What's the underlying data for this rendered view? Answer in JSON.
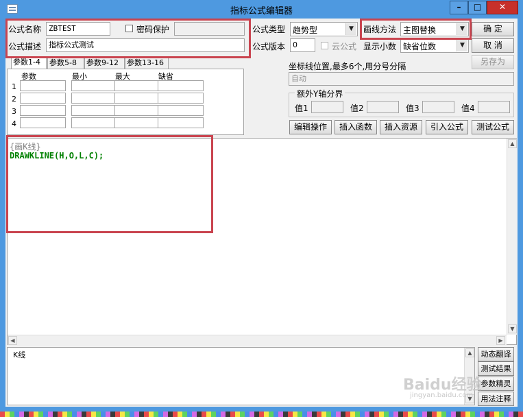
{
  "window": {
    "title": "指标公式编辑器",
    "minimize_label": "–",
    "maximize_label": "□",
    "close_label": "✕"
  },
  "form": {
    "name_label": "公式名称",
    "name_value": "ZBTEST",
    "password_label": "密码保护",
    "desc_label": "公式描述",
    "desc_value": "指标公式测试",
    "type_label": "公式类型",
    "type_value": "趋势型",
    "version_label": "公式版本",
    "version_value": "0",
    "cloud_label": "云公式",
    "draw_method_label": "画线方法",
    "draw_method_value": "主图替换",
    "decimal_label": "显示小数",
    "decimal_value": "缺省位数"
  },
  "buttons": {
    "ok": "确  定",
    "cancel": "取  消",
    "save_as": "另存为",
    "edit_ops": "编辑操作",
    "insert_func": "插入函数",
    "insert_res": "插入资源",
    "import_formula": "引入公式",
    "test_formula": "测试公式",
    "dynamic_translate": "动态翻译",
    "test_result": "测试结果",
    "param_wizard": "参数精灵",
    "usage_note": "用法注释"
  },
  "params": {
    "tabs": [
      "参数1-4",
      "参数5-8",
      "参数9-12",
      "参数13-16"
    ],
    "headers": [
      "参数",
      "最小",
      "最大",
      "缺省"
    ],
    "rows": [
      "1",
      "2",
      "3",
      "4"
    ]
  },
  "axis": {
    "label": "坐标线位置,最多6个,用分号分隔",
    "value": "自动",
    "group_title": "额外Y轴分界",
    "v1": "值1",
    "v2": "值2",
    "v3": "值3",
    "v4": "值4"
  },
  "editor": {
    "comment": "{画K线}",
    "code": "DRAWKLINE(H,O,L,C);"
  },
  "output": {
    "text": "K线"
  },
  "watermark": {
    "text": "Baidu经验",
    "sub": "jingyan.baidu.com"
  }
}
